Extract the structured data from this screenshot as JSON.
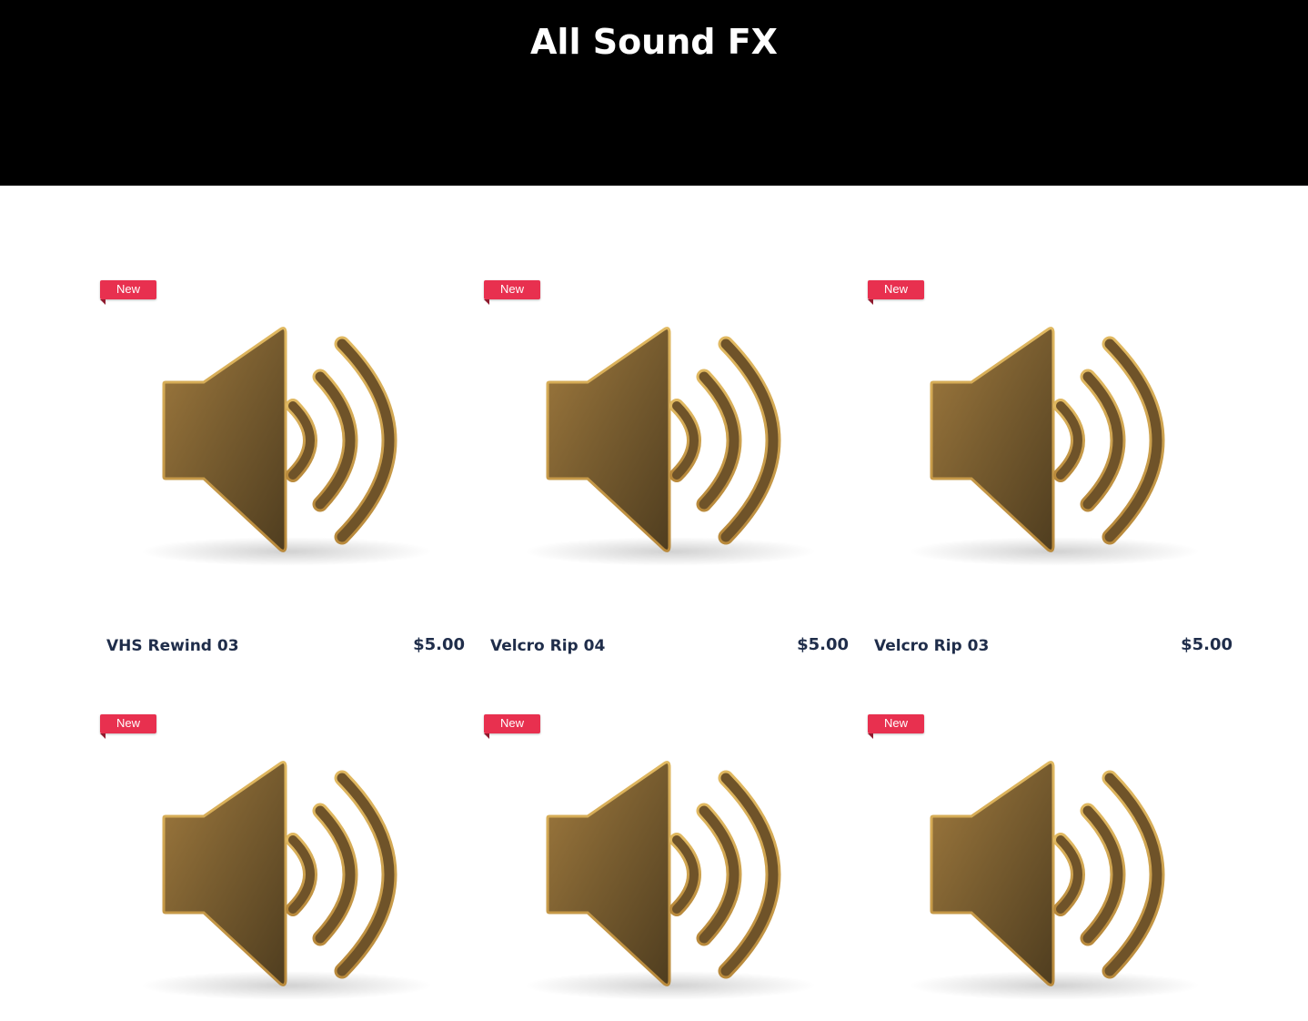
{
  "page": {
    "title": "All Sound FX"
  },
  "products": [
    {
      "badge": "New",
      "name": "VHS Rewind 03",
      "price": "$5.00",
      "image_icon": "speaker-icon"
    },
    {
      "badge": "New",
      "name": "Velcro Rip 04",
      "price": "$5.00",
      "image_icon": "speaker-icon"
    },
    {
      "badge": "New",
      "name": "Velcro Rip 03",
      "price": "$5.00",
      "image_icon": "speaker-icon"
    },
    {
      "badge": "New",
      "name": "",
      "price": "",
      "image_icon": "speaker-icon"
    },
    {
      "badge": "New",
      "name": "",
      "price": "",
      "image_icon": "speaker-icon"
    },
    {
      "badge": "New",
      "name": "",
      "price": "",
      "image_icon": "speaker-icon"
    }
  ],
  "colors": {
    "header_bg": "#000000",
    "badge_bg": "#e8304f",
    "text_dark": "#1f2d4a",
    "speaker_gold": "#8a6a35"
  }
}
